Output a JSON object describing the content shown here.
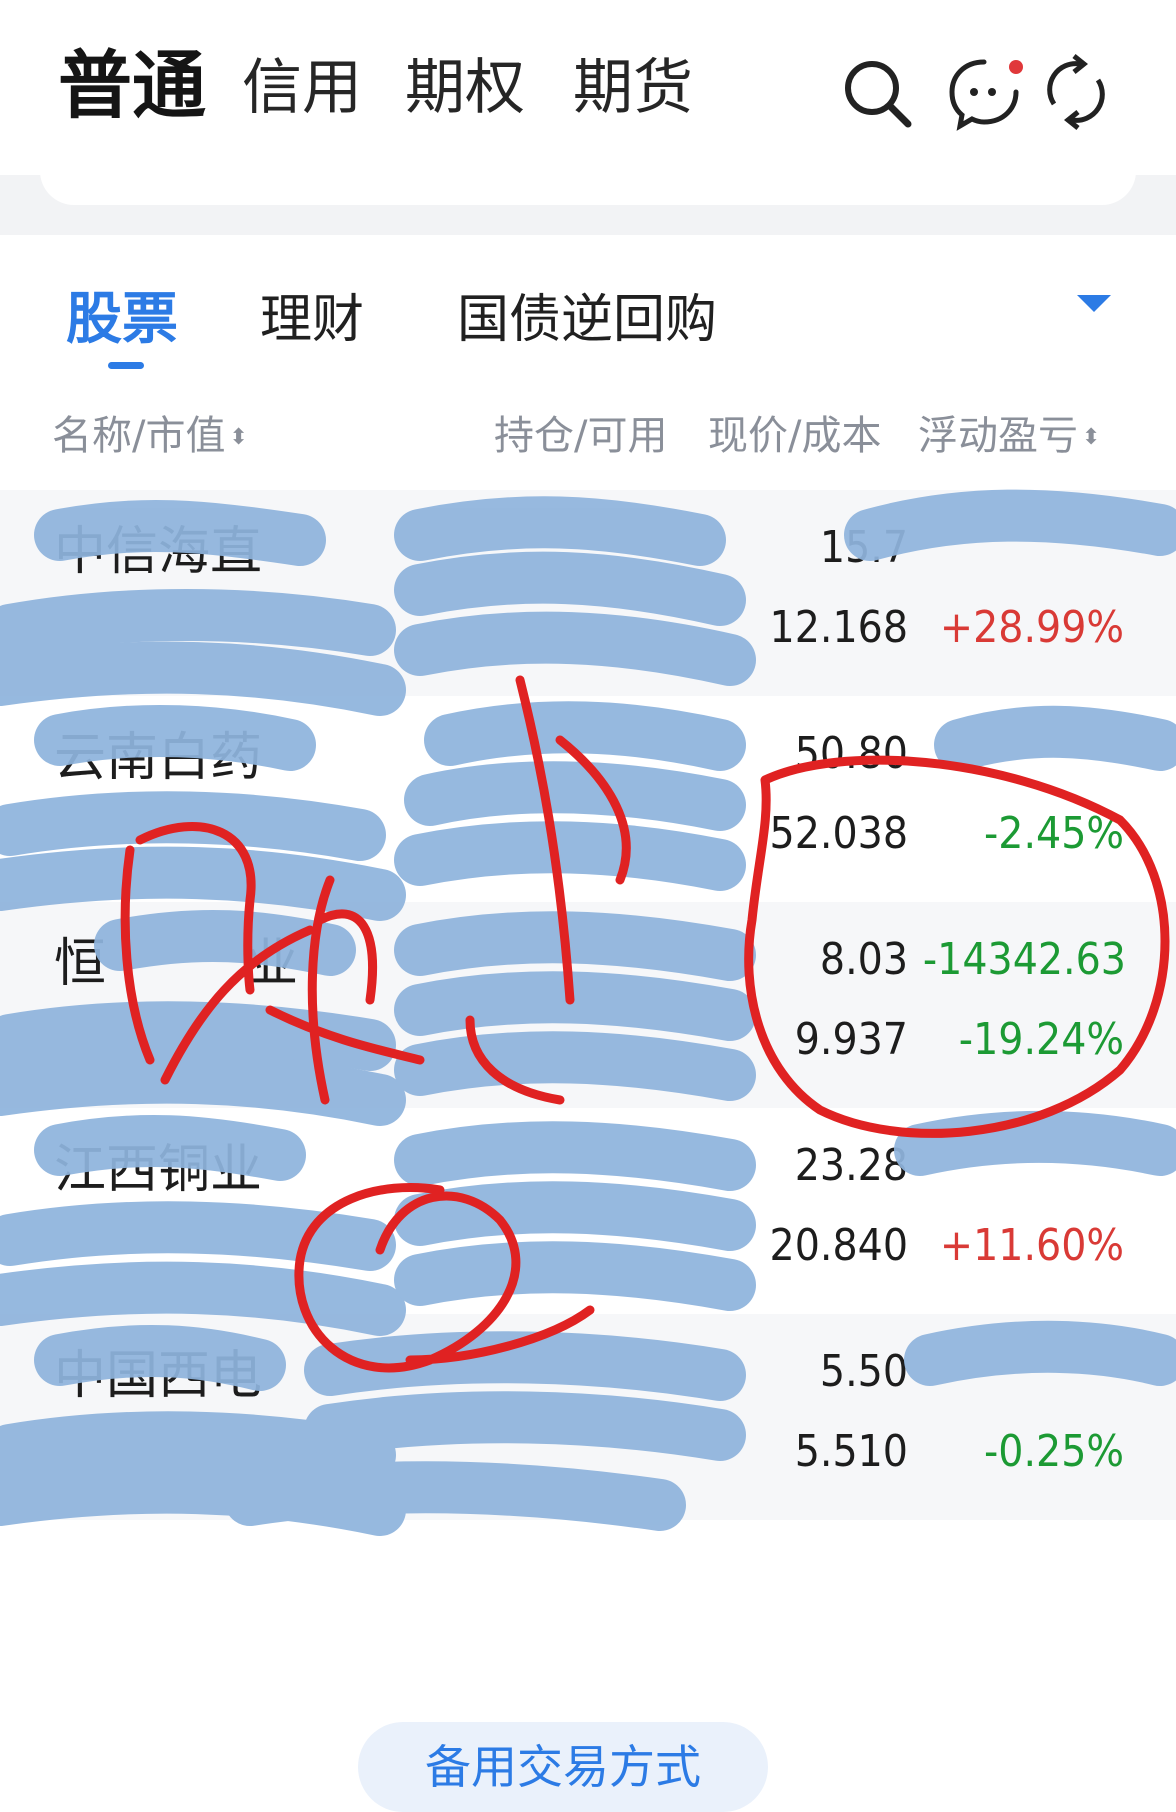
{
  "top_tabs": [
    "普通",
    "信用",
    "期权",
    "期货"
  ],
  "sub_tabs": [
    "股票",
    "理财",
    "国债逆回购"
  ],
  "columns": {
    "name_value": "名称/市值",
    "holding_available": "持仓/可用",
    "price_cost": "现价/成本",
    "floating_pl": "浮动盈亏"
  },
  "rows": [
    {
      "name": "中信海直",
      "price": "15.7",
      "cost": "12.168",
      "pl": "",
      "pct": "+28.99%",
      "trend": "up"
    },
    {
      "name": "云南白药",
      "price": "50.80",
      "cost": "52.038",
      "pl": "",
      "pct": "-2.45%",
      "trend": "down"
    },
    {
      "name": "恒",
      "name2": "业",
      "price": "8.03",
      "cost": "9.937",
      "pl": "-14342.63",
      "pct": "-19.24%",
      "trend": "down"
    },
    {
      "name": "江西铜业",
      "price": "23.28",
      "cost": "20.840",
      "pl": "",
      "pct": "+11.60%",
      "trend": "up"
    },
    {
      "name": "中国西电",
      "price": "5.50",
      "cost": "5.510",
      "pl": "",
      "pct": "-0.25%",
      "trend": "down"
    }
  ],
  "bottom_button": "备用交易方式",
  "colors": {
    "accent": "#2c7be5",
    "up": "#d93a36",
    "down": "#1c9a34",
    "scribble": "#8fb4dd",
    "annotation": "#e02222"
  },
  "icons": [
    "search-icon",
    "message-icon",
    "refresh-icon",
    "sort-icon",
    "dropdown-caret-icon"
  ]
}
